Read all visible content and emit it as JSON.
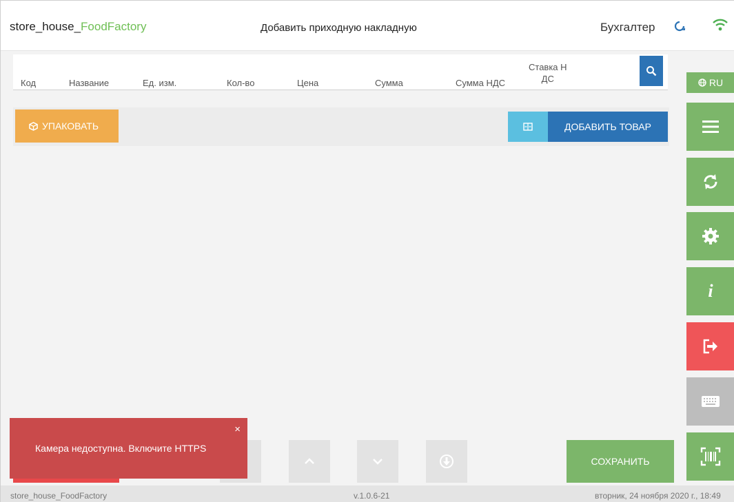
{
  "header": {
    "app_name_prefix": "store_house_",
    "app_name_accent": "FoodFactory",
    "page_title": "Добавить приходную накладную",
    "role": "Бухгалтер"
  },
  "table": {
    "columns": {
      "code": "Код",
      "name": "Название",
      "unit": "Ед. изм.",
      "qty": "Кол-во",
      "price": "Цена",
      "sum": "Сумма",
      "vat_sum": "Сумма НДС",
      "vat_rate_line1": "Ставка Н",
      "vat_rate_line2": "ДС"
    }
  },
  "toolbar": {
    "pack_label": "УПАКОВАТЬ",
    "add_item_label": "ДОБАВИТЬ ТОВАР"
  },
  "sidebar": {
    "lang_label": "RU"
  },
  "footer": {
    "save_label": "СОХРАНИТЬ"
  },
  "toast": {
    "message": "Камера недоступна. Включите HTTPS",
    "close_symbol": "×"
  },
  "statusbar": {
    "app": "store_house_FoodFactory",
    "version": "v.1.0.6-21",
    "datetime": "вторник, 24 ноября 2020 г., 18:49"
  },
  "colors": {
    "accent_green": "#7cb66a",
    "brand_blue": "#2c73b5",
    "warning_orange": "#f0ac4d",
    "danger_red": "#ef5558",
    "toast_red": "#c94a4b"
  }
}
